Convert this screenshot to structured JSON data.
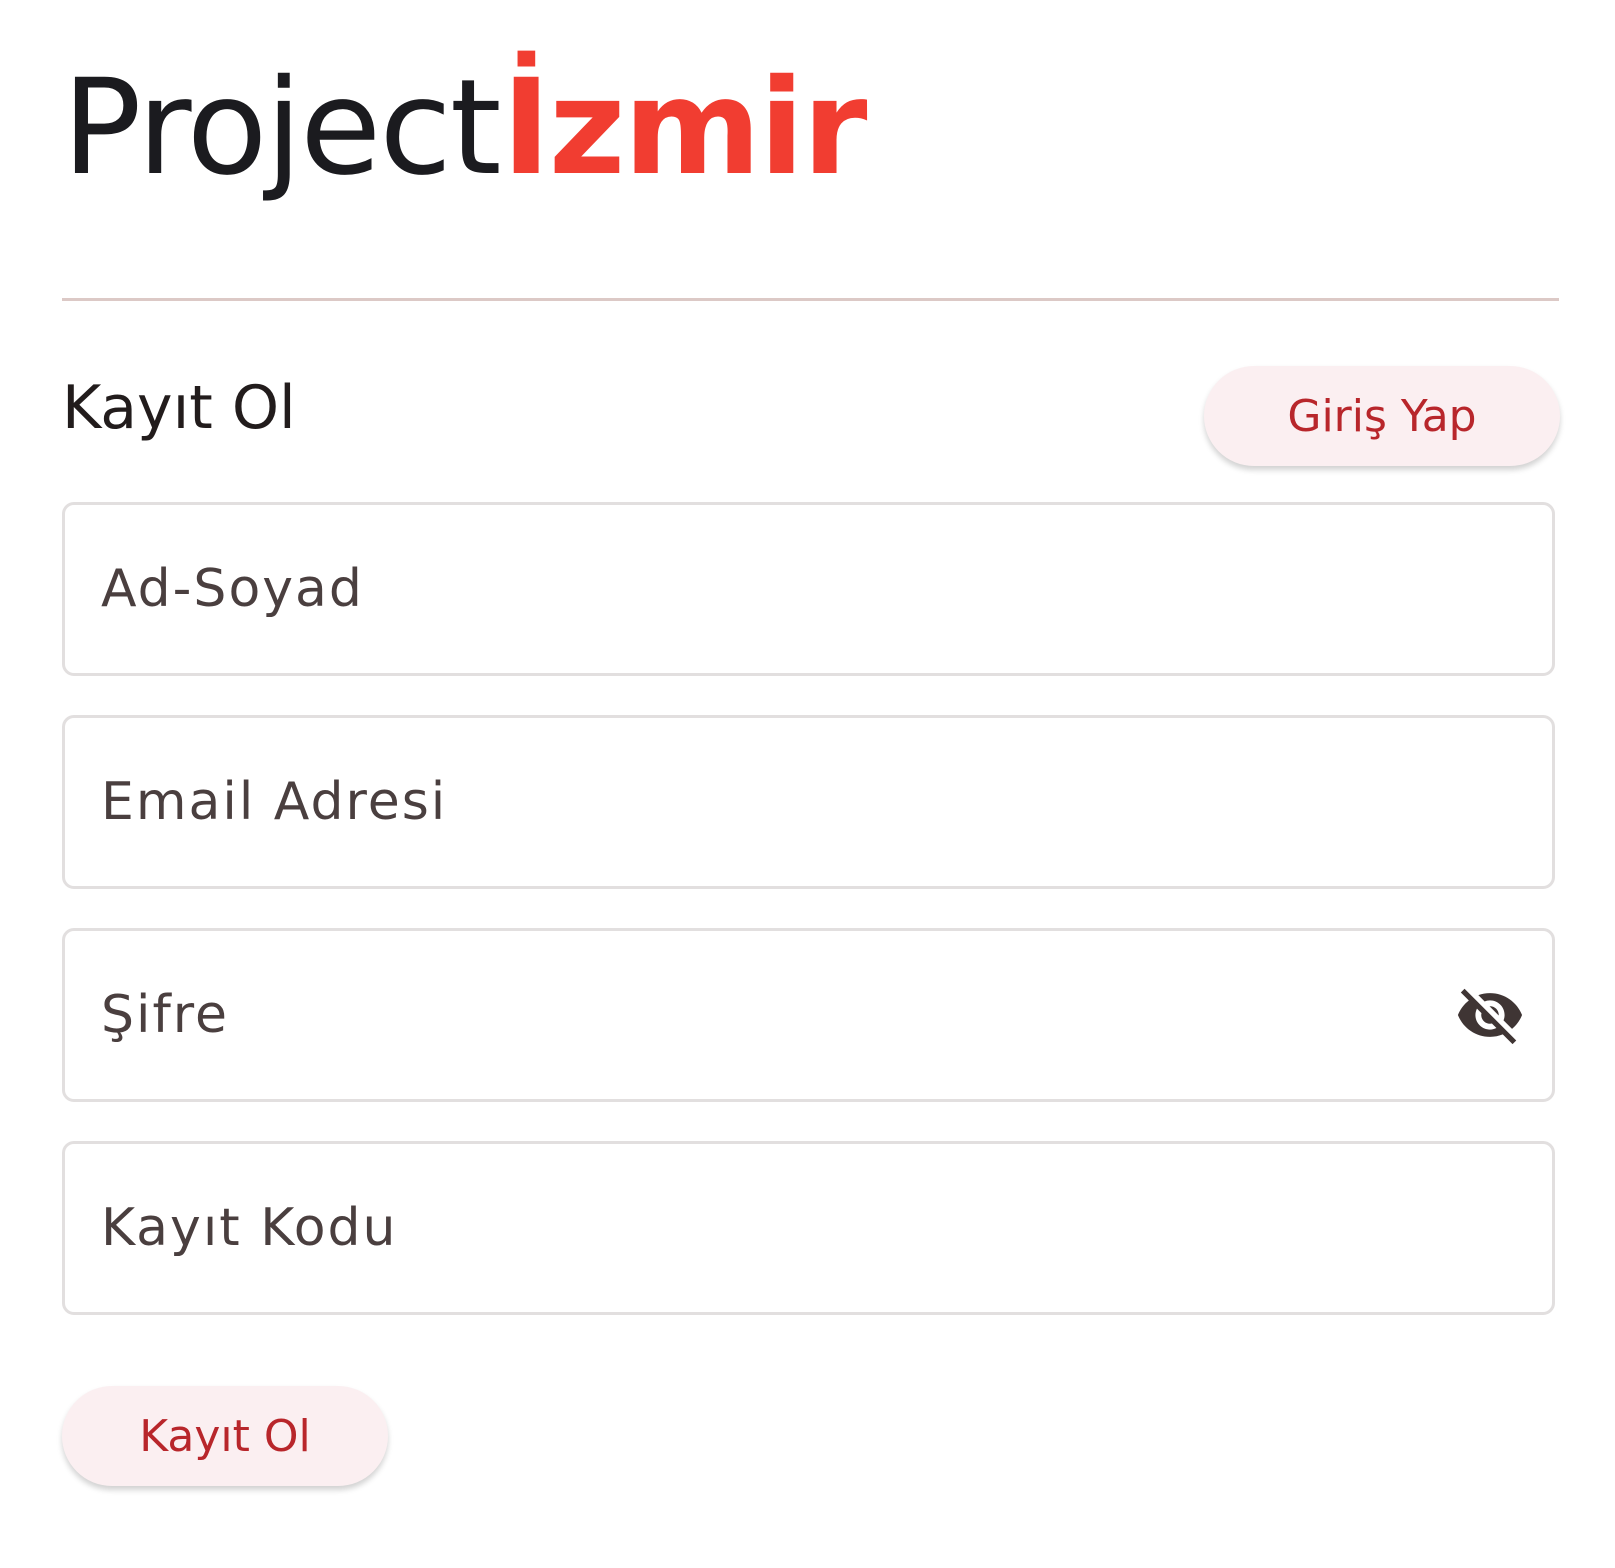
{
  "brand": {
    "part1": "Project",
    "part2": "İzmir",
    "colors": {
      "dark": "#1b1b1f",
      "accent": "#f13d31"
    }
  },
  "form": {
    "title": "Kayıt Ol",
    "login_button_label": "Giriş Yap",
    "fields": {
      "name": {
        "placeholder": "Ad-Soyad",
        "value": ""
      },
      "email": {
        "placeholder": "Email Adresi",
        "value": ""
      },
      "password": {
        "placeholder": "Şifre",
        "value": "",
        "visibility_icon": "visibility-off-icon"
      },
      "code": {
        "placeholder": "Kayıt Kodu",
        "value": ""
      }
    },
    "submit_button_label": "Kayıt Ol"
  },
  "theme": {
    "button_background": "#fbeff1",
    "button_text": "#b8262b",
    "field_border": "#e2dfdf",
    "divider": "#dcc9c6"
  }
}
